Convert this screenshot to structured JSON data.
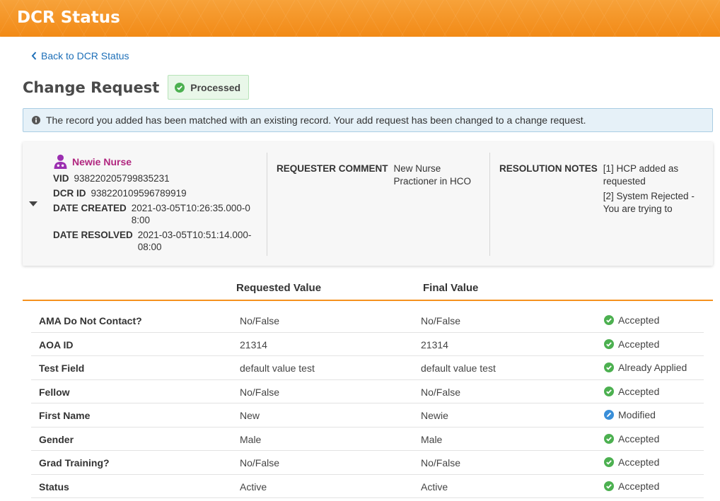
{
  "header": {
    "title": "DCR Status"
  },
  "nav": {
    "back_label": "Back to DCR Status"
  },
  "page": {
    "title": "Change Request",
    "status": "Processed"
  },
  "banner": {
    "message": "The record you added has been matched with an existing record. Your add request has been changed to a change request."
  },
  "summary": {
    "name": "Newie Nurse",
    "vid_label": "VID",
    "vid": "938220205799835231",
    "dcr_id_label": "DCR ID",
    "dcr_id": "938220109596789919",
    "date_created_label": "DATE CREATED",
    "date_created": "2021-03-05T10:26:35.000-08:00",
    "date_resolved_label": "DATE RESOLVED",
    "date_resolved": "2021-03-05T10:51:14.000-08:00",
    "requester_comment_label": "REQUESTER COMMENT",
    "requester_comment": "New Nurse Practioner in HCO",
    "resolution_notes_label": "RESOLUTION NOTES",
    "resolution_notes": [
      "[1] HCP added as requested",
      "[2] System Rejected - You are trying to"
    ]
  },
  "table": {
    "headers": {
      "requested": "Requested Value",
      "final": "Final Value"
    },
    "rows": [
      {
        "field": "AMA Do Not Contact?",
        "requested": "No/False",
        "final": "No/False",
        "status": "Accepted",
        "icon": "check-circle-icon"
      },
      {
        "field": "AOA ID",
        "requested": "21314",
        "final": "21314",
        "status": "Accepted",
        "icon": "check-circle-icon"
      },
      {
        "field": "Test Field",
        "requested": "default value test",
        "final": "default value test",
        "status": "Already Applied",
        "icon": "check-circle-icon"
      },
      {
        "field": "Fellow",
        "requested": "No/False",
        "final": "No/False",
        "status": "Accepted",
        "icon": "check-circle-icon"
      },
      {
        "field": "First Name",
        "requested": "New",
        "final": "Newie",
        "status": "Modified",
        "icon": "pencil-circle-icon"
      },
      {
        "field": "Gender",
        "requested": "Male",
        "final": "Male",
        "status": "Accepted",
        "icon": "check-circle-icon"
      },
      {
        "field": "Grad Training?",
        "requested": "No/False",
        "final": "No/False",
        "status": "Accepted",
        "icon": "check-circle-icon"
      },
      {
        "field": "Status",
        "requested": "Active",
        "final": "Active",
        "status": "Accepted",
        "icon": "check-circle-icon"
      }
    ]
  },
  "colors": {
    "header": "#f5921e",
    "accent_link": "#1d6fb8",
    "hcp_name": "#b0267f",
    "success": "#4cb050",
    "modified": "#3a8fd9"
  }
}
